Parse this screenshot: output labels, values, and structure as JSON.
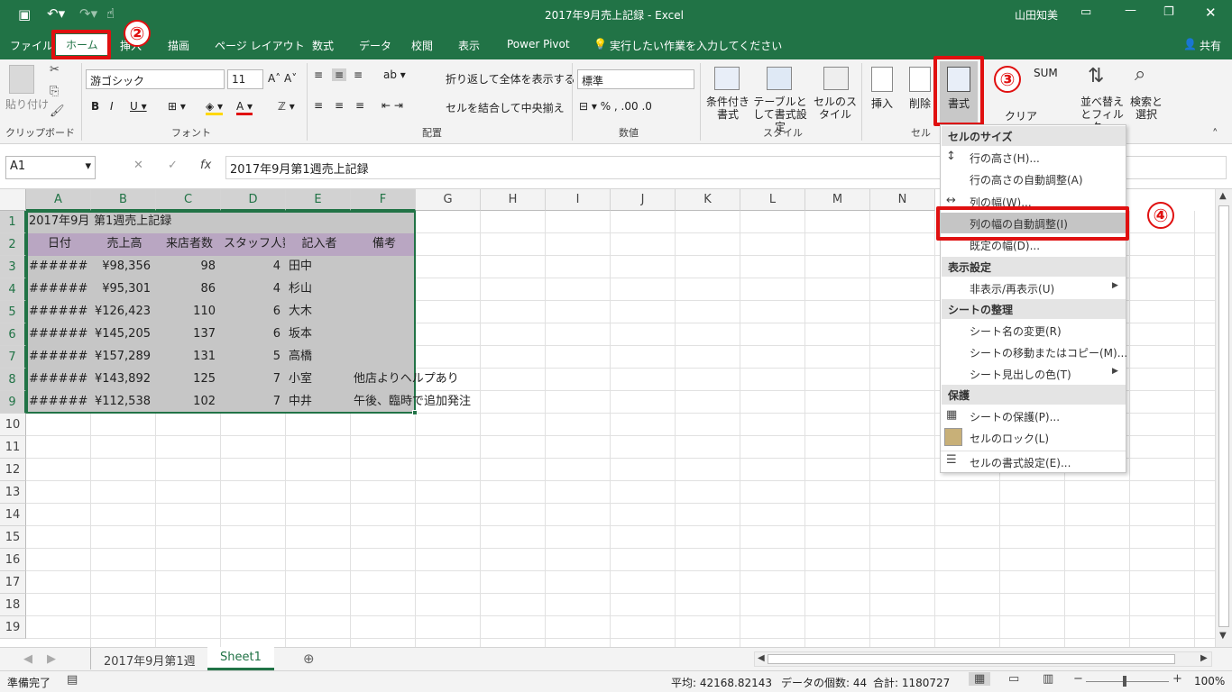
{
  "title": {
    "text": "2017年9月売上記録 - Excel",
    "user": "山田知美"
  },
  "tabs": [
    "ファイル",
    "ホーム",
    "挿入",
    "描画",
    "ページ レイアウト",
    "数式",
    "データ",
    "校閲",
    "表示",
    "Power Pivot"
  ],
  "tellme": "実行したい作業を入力してください",
  "share": "共有",
  "ribbon": {
    "clipboard": {
      "paste": "貼り付け",
      "label": "クリップボード"
    },
    "font": {
      "name": "游ゴシック",
      "size": "11",
      "label": "フォント"
    },
    "align": {
      "wrap": "折り返して全体を表示する",
      "merge": "セルを結合して中央揃え",
      "label": "配置"
    },
    "number": {
      "format": "標準",
      "label": "数値"
    },
    "styles": {
      "cond": "条件付き書式",
      "table": "テーブルとして書式設定",
      "cell": "セルのスタイル",
      "label": "スタイル"
    },
    "cells": {
      "insert": "挿入",
      "delete": "削除",
      "format": "書式",
      "label": "セル"
    },
    "editing": {
      "sum": "SUM",
      "clear": "クリア",
      "sort": "並べ替えとフィルター",
      "find": "検索と選択"
    }
  },
  "formula": {
    "namebox": "A1",
    "fx": "fx",
    "content": "2017年9月第1週売上記録"
  },
  "columns": [
    "A",
    "B",
    "C",
    "D",
    "E",
    "F",
    "G",
    "H",
    "I",
    "J",
    "K",
    "L",
    "M",
    "N"
  ],
  "rows": [
    "1",
    "2",
    "3",
    "4",
    "5",
    "6",
    "7",
    "8",
    "9",
    "10",
    "11",
    "12",
    "13",
    "14",
    "15",
    "16",
    "17",
    "18",
    "19"
  ],
  "sheet": {
    "a1": "2017年9月",
    "b1": "第1週売上記録",
    "headers": [
      "日付",
      "売上高",
      "来店者数",
      "スタッフ人数",
      "記入者",
      "備考"
    ],
    "data": [
      [
        "#######",
        "¥98,356",
        "98",
        "4",
        "田中",
        ""
      ],
      [
        "#######",
        "¥95,301",
        "86",
        "4",
        "杉山",
        ""
      ],
      [
        "#######",
        "¥126,423",
        "110",
        "6",
        "大木",
        ""
      ],
      [
        "#######",
        "¥145,205",
        "137",
        "6",
        "坂本",
        ""
      ],
      [
        "#######",
        "¥157,289",
        "131",
        "5",
        "高橋",
        ""
      ],
      [
        "#######",
        "¥143,892",
        "125",
        "7",
        "小室",
        "他店よりヘルプあり"
      ],
      [
        "#######",
        "¥112,538",
        "102",
        "7",
        "中井",
        "午後、臨時で追加発注"
      ]
    ]
  },
  "menu": {
    "sec1": "セルのサイズ",
    "rowHeight": "行の高さ(H)...",
    "rowAuto": "行の高さの自動調整(A)",
    "colWidth": "列の幅(W)...",
    "colAuto": "列の幅の自動調整(I)",
    "defWidth": "既定の幅(D)...",
    "sec2": "表示設定",
    "hide": "非表示/再表示(U)",
    "sec3": "シートの整理",
    "rename": "シート名の変更(R)",
    "move": "シートの移動またはコピー(M)...",
    "tabColor": "シート見出しの色(T)",
    "sec4": "保護",
    "protect": "シートの保護(P)...",
    "lock": "セルのロック(L)",
    "formatCells": "セルの書式設定(E)..."
  },
  "callouts": {
    "c2": "②",
    "c3": "③",
    "c4": "④"
  },
  "sheetTabs": [
    "2017年9月第1週",
    "Sheet1"
  ],
  "status": {
    "ready": "準備完了",
    "avg": "平均: 42168.82143",
    "count": "データの個数: 44",
    "sum": "合計: 1180727",
    "zoom": "100%"
  }
}
